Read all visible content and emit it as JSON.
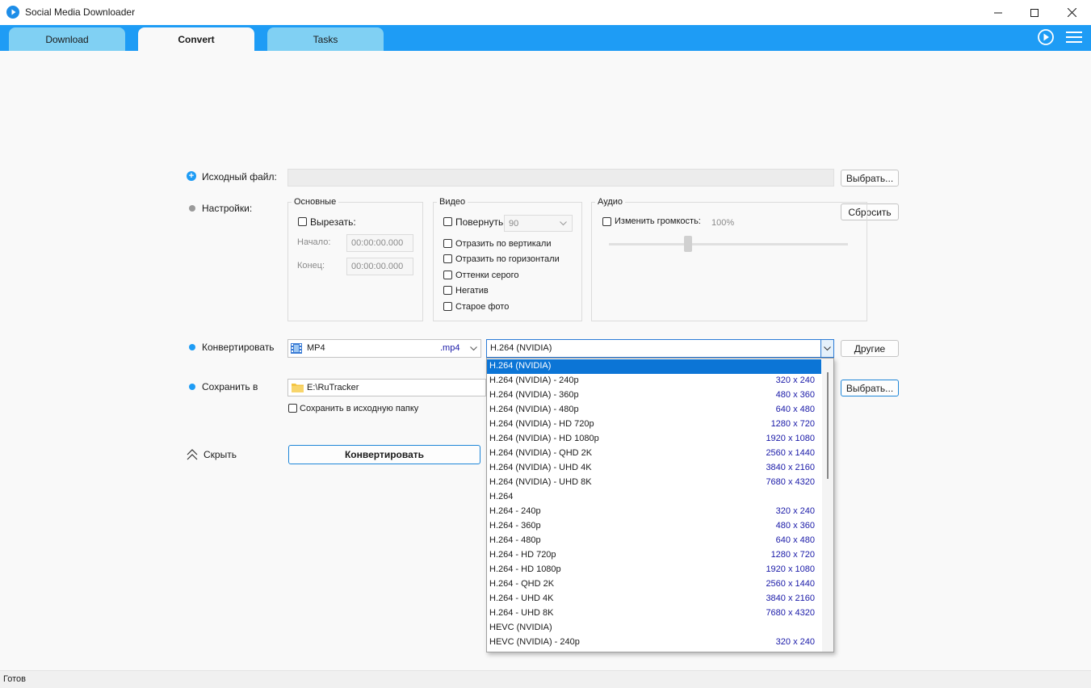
{
  "window": {
    "title": "Social Media Downloader"
  },
  "tabs": [
    {
      "label": "Download"
    },
    {
      "label": "Convert"
    },
    {
      "label": "Tasks"
    }
  ],
  "source": {
    "label": "Исходный файл:",
    "value": "",
    "browse_label": "Выбрать..."
  },
  "settings": {
    "label": "Настройки:",
    "reset_label": "Сбросить",
    "basic": {
      "title": "Основные",
      "cut_label": "Вырезать:",
      "start_label": "Начало:",
      "start_value": "00:00:00.000",
      "end_label": "Конец:",
      "end_value": "00:00:00.000"
    },
    "video": {
      "title": "Видео",
      "rotate_label": "Повернуть",
      "rotate_value": "90",
      "flip_vertical": "Отразить по вертикали",
      "flip_horizontal": "Отразить по горизонтали",
      "grayscale": "Оттенки серого",
      "negative": "Негатив",
      "old_photo": "Старое фото"
    },
    "audio": {
      "title": "Аудио",
      "volume_label": "Изменить громкость:",
      "volume_value": "100%",
      "volume_level": 0.33
    }
  },
  "convert": {
    "label": "Конвертировать",
    "format_name": "MP4",
    "format_ext": ".mp4",
    "codec_value": "H.264 (NVIDIA)",
    "other_label": "Другие"
  },
  "save": {
    "label": "Сохранить в",
    "path": "E:\\RuTracker",
    "browse_label": "Выбрать...",
    "same_folder_label": "Сохранить в исходную папку"
  },
  "hide_label": "Скрыть",
  "convert_button_label": "Конвертировать",
  "codec_options": [
    {
      "name": "H.264 (NVIDIA)",
      "res": "",
      "selected": true
    },
    {
      "name": "H.264 (NVIDIA) - 240p",
      "res": "320 x 240"
    },
    {
      "name": "H.264 (NVIDIA) - 360p",
      "res": "480 x 360"
    },
    {
      "name": "H.264 (NVIDIA) - 480p",
      "res": "640 x 480"
    },
    {
      "name": "H.264 (NVIDIA) - HD 720p",
      "res": "1280 x 720"
    },
    {
      "name": "H.264 (NVIDIA) - HD 1080p",
      "res": "1920 x 1080"
    },
    {
      "name": "H.264 (NVIDIA) - QHD 2K",
      "res": "2560 x 1440"
    },
    {
      "name": "H.264 (NVIDIA) - UHD 4K",
      "res": "3840 x 2160"
    },
    {
      "name": "H.264 (NVIDIA) - UHD 8K",
      "res": "7680 x 4320"
    },
    {
      "name": "H.264",
      "res": ""
    },
    {
      "name": "H.264 - 240p",
      "res": "320 x 240"
    },
    {
      "name": "H.264 - 360p",
      "res": "480 x 360"
    },
    {
      "name": "H.264 - 480p",
      "res": "640 x 480"
    },
    {
      "name": "H.264 - HD 720p",
      "res": "1280 x 720"
    },
    {
      "name": "H.264 - HD 1080p",
      "res": "1920 x 1080"
    },
    {
      "name": "H.264 - QHD 2K",
      "res": "2560 x 1440"
    },
    {
      "name": "H.264 - UHD 4K",
      "res": "3840 x 2160"
    },
    {
      "name": "H.264 - UHD 8K",
      "res": "7680 x 4320"
    },
    {
      "name": "HEVC (NVIDIA)",
      "res": ""
    },
    {
      "name": "HEVC (NVIDIA) - 240p",
      "res": "320 x 240"
    }
  ],
  "status": {
    "text": "Готов"
  },
  "colors": {
    "accent": "#1e9cf5",
    "tab_inactive": "#80d0f3",
    "selection": "#0c75d6",
    "resolution_text": "#1a1aa8"
  },
  "icons": {
    "app": "play-bubble-icon",
    "menu": "hamburger-icon",
    "play": "play-circle-icon",
    "folder": "folder-icon",
    "film": "film-icon"
  }
}
